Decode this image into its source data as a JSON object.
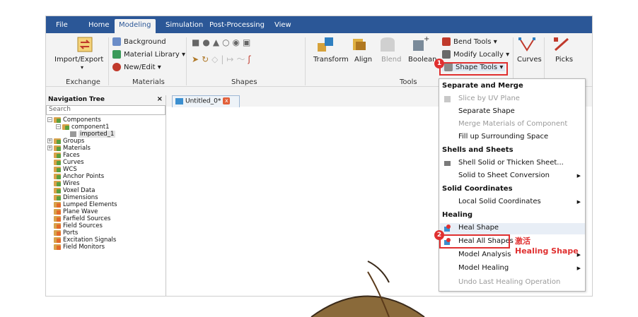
{
  "menu": {
    "tabs": [
      "File",
      "Home",
      "Modeling",
      "Simulation",
      "Post-Processing",
      "View"
    ],
    "active": "Modeling"
  },
  "ribbon": {
    "exchange": {
      "button": "Import/Export",
      "label": "Exchange"
    },
    "materials": {
      "items": [
        "Background",
        "Material Library",
        "New/Edit"
      ],
      "label": "Materials"
    },
    "shapes": {
      "label": "Shapes"
    },
    "tools": {
      "buttons": [
        "Transform",
        "Align",
        "Blend",
        "Boolean"
      ],
      "menus": [
        "Bend Tools",
        "Modify Locally",
        "Shape Tools"
      ],
      "label": "Tools"
    },
    "curves": {
      "button": "Curves"
    },
    "picks": {
      "button": "Picks"
    }
  },
  "nav_tree": {
    "title": "Navigation Tree",
    "close": "×",
    "search_placeholder": "Search",
    "items": [
      "Components",
      "component1",
      "imported_1",
      "Groups",
      "Materials",
      "Faces",
      "Curves",
      "WCS",
      "Anchor Points",
      "Wires",
      "Voxel Data",
      "Dimensions",
      "Lumped Elements",
      "Plane Wave",
      "Farfield Sources",
      "Field Sources",
      "Ports",
      "Excitation Signals",
      "Field Monitors"
    ]
  },
  "doc_tab": {
    "title": "Untitled_0*",
    "close": "x"
  },
  "dropdown": {
    "sections": [
      {
        "title": "Separate and Merge",
        "items": [
          {
            "label": "Slice by UV Plane",
            "disabled": true,
            "icon": true
          },
          {
            "label": "Separate Shape",
            "disabled": false
          },
          {
            "label": "Merge Materials of Component",
            "disabled": true
          },
          {
            "label": "Fill up Surrounding Space",
            "disabled": false
          }
        ]
      },
      {
        "title": "Shells and Sheets",
        "items": [
          {
            "label": "Shell Solid or Thicken Sheet...",
            "disabled": false,
            "icon": true
          },
          {
            "label": "Solid to Sheet Conversion",
            "disabled": false,
            "arrow": true
          }
        ]
      },
      {
        "title": "Solid Coordinates",
        "items": [
          {
            "label": "Local Solid Coordinates",
            "disabled": false,
            "arrow": true
          }
        ]
      },
      {
        "title": "Healing",
        "items": [
          {
            "label": "Heal Shape",
            "disabled": false,
            "icon": true
          },
          {
            "label": "Heal All Shapes",
            "disabled": false,
            "icon": true
          },
          {
            "label": "Model Analysis",
            "disabled": false,
            "arrow": true
          },
          {
            "label": "Model Healing",
            "disabled": false,
            "arrow": true
          },
          {
            "label": "Undo Last Healing Operation",
            "disabled": true
          }
        ]
      }
    ]
  },
  "annotations": {
    "badge1": "1",
    "badge2": "2",
    "note_line1": "激活",
    "note_line2": "Healing Shape"
  },
  "colors": {
    "menubar": "#2b5797",
    "highlight_red": "#e03030"
  }
}
